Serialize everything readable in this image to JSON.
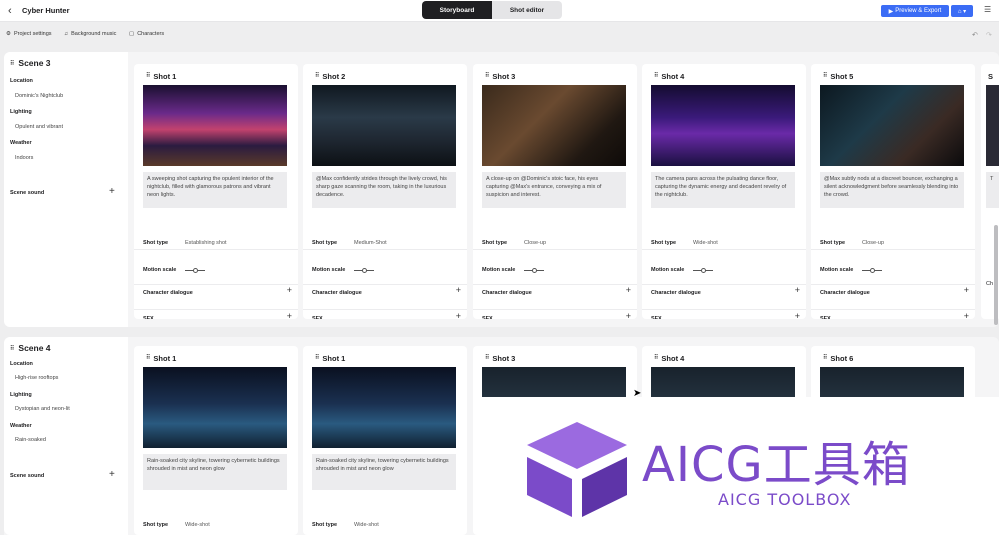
{
  "header": {
    "app_title": "Cyber Hunter",
    "tabs": [
      {
        "label": "Storyboard"
      },
      {
        "label": "Shot editor"
      }
    ],
    "export_label": "Preview & Export"
  },
  "toolbar": {
    "items": [
      {
        "label": "Project settings"
      },
      {
        "label": "Background music"
      },
      {
        "label": "Characters"
      }
    ]
  },
  "labels": {
    "location": "Location",
    "lighting": "Lighting",
    "weather": "Weather",
    "scene_sound": "Scene sound",
    "shot_type": "Shot type",
    "motion_scale": "Motion scale",
    "character_dialogue": "Character dialogue",
    "sfx": "SFX"
  },
  "scenes": [
    {
      "title": "Scene 3",
      "location": "Dominic's Nightclub",
      "lighting": "Opulent and vibrant",
      "weather": "Indoors",
      "shots": [
        {
          "title": "Shot 1",
          "desc": "A sweeping shot capturing the opulent interior of the nightclub, filled with glamorous patrons and vibrant neon lights.",
          "type": "Establishing shot",
          "motion": 0.5
        },
        {
          "title": "Shot 2",
          "desc": "@Max confidently strides through the lively crowd, his sharp gaze scanning the room, taking in the luxurious decadence.",
          "type": "Medium-Shot",
          "motion": 0.5
        },
        {
          "title": "Shot 3",
          "desc": "A close-up on @Dominic's stoic face, his eyes capturing @Max's entrance, conveying a mix of suspicion and interest.",
          "type": "Close-up",
          "motion": 0.5
        },
        {
          "title": "Shot 4",
          "desc": "The camera pans across the pulsating dance floor, capturing the dynamic energy and decadent revelry of the nightclub.",
          "type": "Wide-shot",
          "motion": 0.5
        },
        {
          "title": "Shot 5",
          "desc": "@Max subtly nods at a discreet bouncer, exchanging a silent acknowledgment before seamlessly blending into the crowd.",
          "type": "Close-up",
          "motion": 0.5
        }
      ],
      "partial_shot": {
        "title": "S",
        "desc": "T",
        "type": "",
        "dialogue": "Ch"
      }
    },
    {
      "title": "Scene 4",
      "location": "High-rise rooftops",
      "lighting": "Dystopian and neon-lit",
      "weather": "Rain-soaked",
      "shots": [
        {
          "title": "Shot 1",
          "desc": "Rain-soaked city skyline, towering cybernetic buildings shrouded in mist and neon glow",
          "type": "Wide-shot"
        },
        {
          "title": "Shot 1",
          "desc": "Rain-soaked city skyline, towering cybernetic buildings shrouded in mist and neon glow",
          "type": "Wide-shot"
        },
        {
          "title": "Shot 3"
        },
        {
          "title": "Shot 4"
        },
        {
          "title": "Shot 6"
        }
      ]
    }
  ],
  "watermark": {
    "main": "AICG工具箱",
    "sub": "AICG TOOLBOX"
  },
  "colors": {
    "accent": "#3b6cf5",
    "dark_tab": "#1f1f22",
    "watermark": "#7b4bc9"
  }
}
